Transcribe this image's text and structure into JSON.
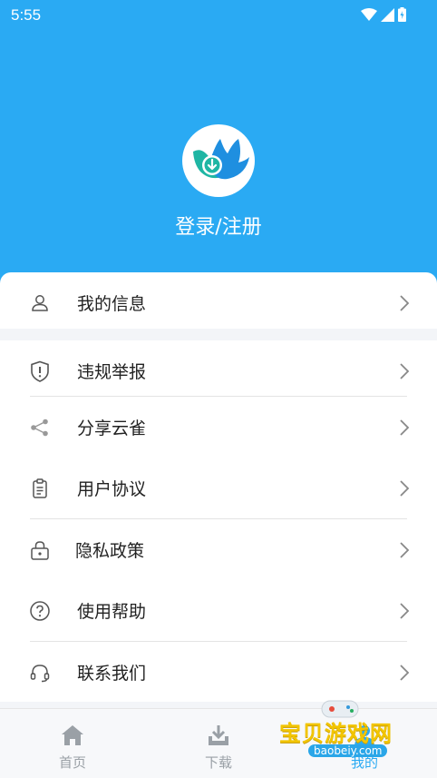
{
  "status_bar": {
    "time": "5:55"
  },
  "profile": {
    "login_label": "登录/注册"
  },
  "menu": {
    "my_info": "我的信息",
    "items": [
      {
        "label": "违规举报",
        "icon": "shield-alert-icon"
      },
      {
        "label": "分享云雀",
        "icon": "share-icon"
      },
      {
        "label": "用户协议",
        "icon": "clipboard-icon"
      },
      {
        "label": "隐私政策",
        "icon": "lock-icon"
      },
      {
        "label": "使用帮助",
        "icon": "help-circle-icon"
      },
      {
        "label": "联系我们",
        "icon": "headset-icon"
      }
    ]
  },
  "tabs": [
    {
      "label": "首页",
      "icon": "home-icon"
    },
    {
      "label": "下载",
      "icon": "download-icon"
    },
    {
      "label": "我的",
      "icon": "user-icon"
    }
  ],
  "watermark": {
    "title": "宝贝游戏网",
    "sub": "baobeiy.com"
  },
  "colors": {
    "accent": "#2aaaf3",
    "brand_green": "#1fb6a4",
    "brand_blue": "#1f8fe0"
  }
}
